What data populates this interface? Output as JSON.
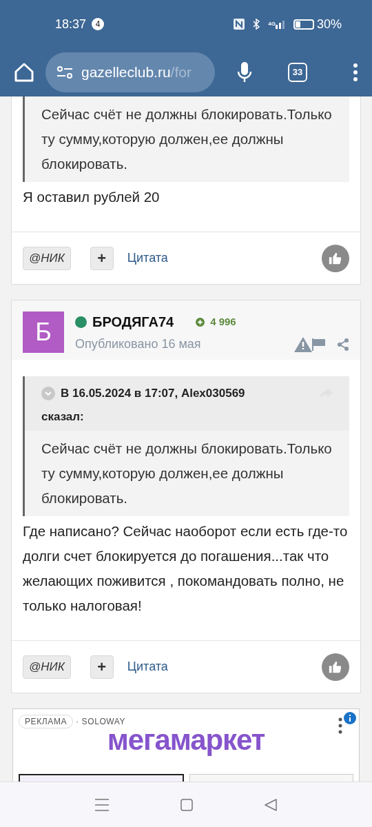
{
  "status_bar": {
    "time": "18:37",
    "notification_count": "4",
    "network": "4G",
    "battery": "30%"
  },
  "browser": {
    "url_host": "gazelleclub.ru",
    "url_path": "/for",
    "tab_count": "33"
  },
  "posts": [
    {
      "kind": "continued",
      "quote": {
        "text": "Сейчас счёт не должны блокировать.Только ту сумму,которую должен,ее должны блокировать."
      },
      "body": "Я оставил рублей 20",
      "actions": {
        "mention": "@НИК",
        "plus": "+",
        "quote": "Цитата"
      }
    },
    {
      "kind": "full",
      "avatar_letter": "Б",
      "online": true,
      "author": "БРОДЯГА74",
      "reputation": "4 996",
      "published": "Опубликовано 16 мая",
      "quote": {
        "header": "В 16.05.2024 в 17:07, Alex030569",
        "said": "сказал:",
        "text": "Сейчас счёт не должны блокировать.Только ту сумму,которую должен,ее должны блокировать."
      },
      "body": "Где написано? Сейчас наоборот если есть где-то долги счет блокируется до погашения...так что желающих поживится , покомандовать полно, не только налоговая!",
      "actions": {
        "mention": "@НИК",
        "plus": "+",
        "quote": "Цитата"
      }
    }
  ],
  "ad": {
    "label": "РЕКЛАМА",
    "sponsor": "· SOLOWAY",
    "brand": "мегамаркет"
  }
}
